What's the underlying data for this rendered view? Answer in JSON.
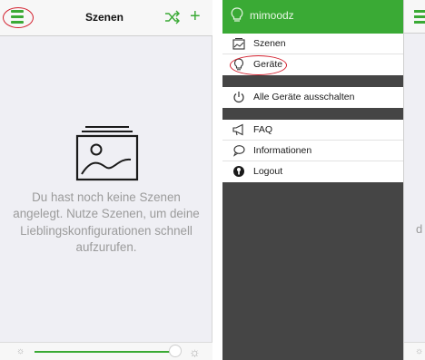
{
  "left_screen": {
    "title": "Szenen",
    "empty_message": "Du hast noch keine Szenen angelegt. Nutze Szenen, um deine Lieblingskonfigurationen schnell aufzurufen.",
    "brightness_level": 0.95,
    "accent_color": "#3aaa35",
    "highlight_color": "#d3202e",
    "icons": [
      "menu-icon",
      "shuffle-icon",
      "plus-icon",
      "photo-placeholder-icon",
      "sun-small-icon",
      "sun-large-icon"
    ]
  },
  "right_screen": {
    "brand": "mimoodz",
    "groups": [
      [
        {
          "label": "Szenen",
          "icon": "scenes-icon"
        },
        {
          "label": "Geräte",
          "icon": "bulb-icon"
        }
      ],
      [
        {
          "label": "Alle Geräte ausschalten",
          "icon": "power-icon"
        }
      ],
      [
        {
          "label": "FAQ",
          "icon": "megaphone-icon"
        },
        {
          "label": "Informationen",
          "icon": "chat-bubble-icon"
        },
        {
          "label": "Logout",
          "icon": "logout-icon"
        }
      ]
    ],
    "peek_letter": "d"
  }
}
